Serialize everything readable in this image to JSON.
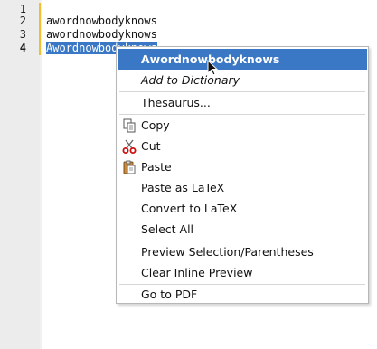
{
  "gutter": {
    "line_numbers": [
      "1",
      "2",
      "3",
      "4"
    ]
  },
  "editor": {
    "lines": [
      "",
      "awordnowbodyknows",
      "awordnowbodyknows",
      "Awordnowbodyknows"
    ]
  },
  "context_menu": {
    "items": [
      {
        "label": "Awordnowbodyknows"
      },
      {
        "label": "Add to Dictionary"
      },
      {
        "label": "Thesaurus..."
      },
      {
        "label": "Copy",
        "icon": "copy-icon"
      },
      {
        "label": "Cut",
        "icon": "scissors-icon"
      },
      {
        "label": "Paste",
        "icon": "clipboard-icon"
      },
      {
        "label": "Paste as LaTeX"
      },
      {
        "label": "Convert to LaTeX"
      },
      {
        "label": "Select All"
      },
      {
        "label": "Preview Selection/Parentheses"
      },
      {
        "label": "Clear Inline Preview"
      },
      {
        "label": "Go to PDF"
      }
    ]
  },
  "colors": {
    "selection": "#3a78c6",
    "fold_marker": "#f0c030",
    "gutter": "#ececec"
  }
}
